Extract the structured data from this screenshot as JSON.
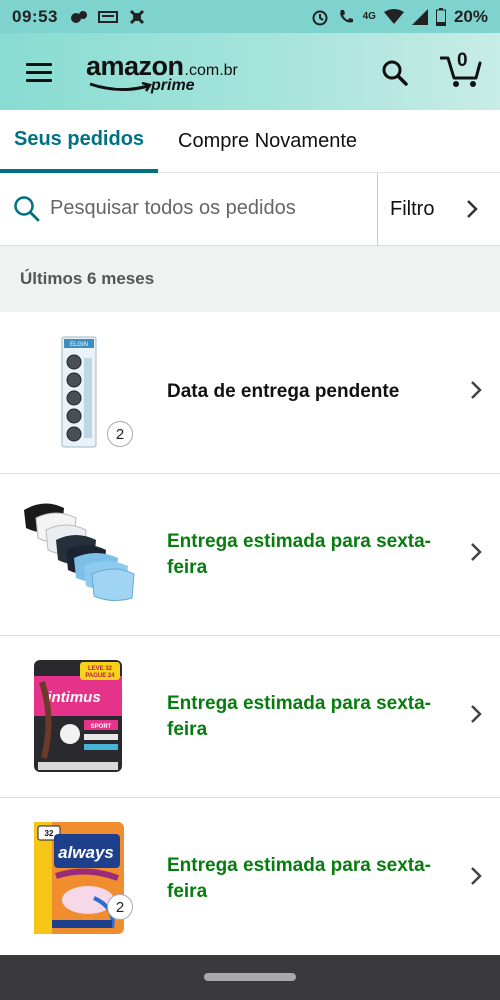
{
  "status_bar": {
    "time": "09:53",
    "network": "4G",
    "battery": "20%"
  },
  "header": {
    "logo_text": "amazon",
    "logo_suffix": ".com.br",
    "logo_prime": "prime",
    "cart_count": "0",
    "brand_color": "#111111",
    "header_color": "#88dcd2"
  },
  "tabs": [
    {
      "label": "Seus pedidos",
      "active": true
    },
    {
      "label": "Compre Novamente",
      "active": false
    }
  ],
  "search": {
    "placeholder": "Pesquisar todos os pedidos",
    "value": "",
    "filter_label": "Filtro"
  },
  "section": {
    "title": "Últimos 6 meses"
  },
  "orders": [
    {
      "product_image": "coin-battery-pack",
      "status": "Data de entrega pendente",
      "status_type": "pending",
      "quantity_badge": "2"
    },
    {
      "product_image": "fabric-masks",
      "status_line1": "Entrega estimada para sexta-",
      "status_line2": "feira",
      "status_type": "estimated"
    },
    {
      "product_image": "intimus-pads",
      "status_line1": "Entrega estimada para sexta-",
      "status_line2": "feira",
      "status_type": "estimated"
    },
    {
      "product_image": "always-pads",
      "status_line1": "Entrega estimada para sexta-",
      "status_line2": "feira",
      "status_type": "estimated",
      "quantity_badge": "2"
    }
  ],
  "colors": {
    "accent": "#007185",
    "estimated_green": "#067d0e",
    "section_bg": "#f0f2f2",
    "nav_bar": "#3a3a3c"
  },
  "product_art": {
    "battery_brand": "ELGIN",
    "intimus_promo_top": "LEVE 32",
    "intimus_promo_bottom": "PAGUE 24",
    "intimus_brand": "intimus",
    "intimus_line": "SPORT",
    "always_badge": "32",
    "always_brand": "always"
  }
}
